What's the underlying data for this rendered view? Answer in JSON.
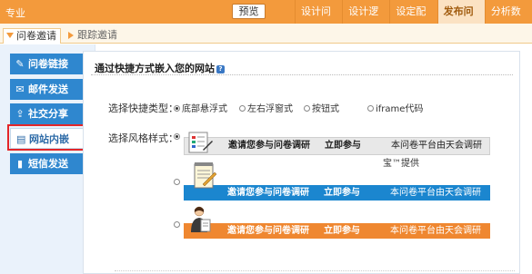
{
  "topbar": {
    "brand": "专业",
    "preview": "预览",
    "nav": [
      "设计问卷",
      "设计逻辑",
      "设定配额",
      "发布问卷",
      "分析数据"
    ],
    "active_nav": "发布问卷"
  },
  "tabs": {
    "active": "问卷邀请",
    "second": "跟踪邀请"
  },
  "sidebar": {
    "items": [
      {
        "label": "问卷链接",
        "icon": "link-icon"
      },
      {
        "label": "邮件发送",
        "icon": "mail-icon"
      },
      {
        "label": "社交分享",
        "icon": "share-icon"
      },
      {
        "label": "网站内嵌",
        "icon": "embed-icon"
      },
      {
        "label": "短信发送",
        "icon": "phone-icon"
      }
    ],
    "current": "网站内嵌"
  },
  "panel": {
    "title": "通过快捷方式嵌入您的网站",
    "quick_type_label": "选择快捷类型：",
    "quick_types": [
      {
        "label": "底部悬浮式",
        "checked": true
      },
      {
        "label": "左右浮窗式",
        "checked": false
      },
      {
        "label": "按钮式",
        "checked": false
      },
      {
        "label": "iframe代码",
        "checked": false
      }
    ],
    "style_label": "选择风格样式：",
    "style_text": {
      "invite": "邀请您参与问卷调研",
      "join": "立即参与",
      "provider": "本问卷平台由天会调研",
      "provider_suffix": "宝™提供"
    },
    "styles": [
      {
        "name": "gray",
        "color": "#e8e8e8",
        "checked": true
      },
      {
        "name": "blue",
        "color": "#1b86cf",
        "checked": false
      },
      {
        "name": "orange",
        "color": "#ef8730",
        "checked": false
      }
    ]
  }
}
